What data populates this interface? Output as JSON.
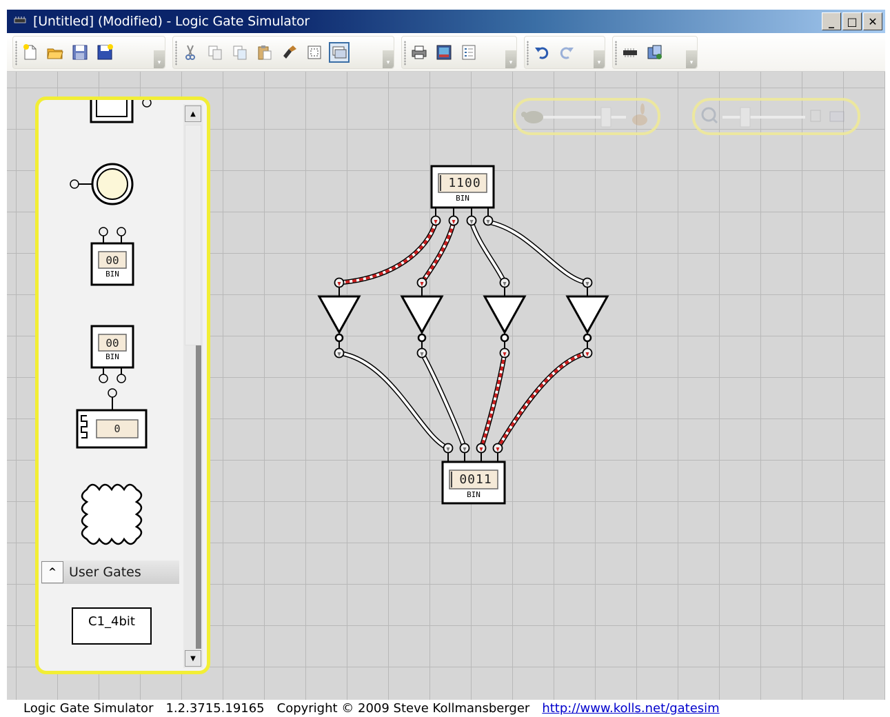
{
  "window": {
    "title": "[Untitled] (Modified) - Logic Gate Simulator",
    "minimize_label": "_",
    "maximize_label": "□",
    "close_label": "✕"
  },
  "toolbar": {
    "groups": [
      {
        "name": "file",
        "icons": [
          "new-icon",
          "open-icon",
          "save-icon",
          "save-as-icon"
        ]
      },
      {
        "name": "edit",
        "icons": [
          "cut-icon",
          "copy-icon",
          "copy-as-image-icon",
          "paste-icon",
          "delete-icon",
          "select-all-icon",
          "wire-mode-icon"
        ]
      },
      {
        "name": "print",
        "icons": [
          "print-icon",
          "print-preview-icon",
          "properties-icon"
        ]
      },
      {
        "name": "history",
        "icons": [
          "undo-icon",
          "redo-icon"
        ]
      },
      {
        "name": "ic",
        "icons": [
          "chip-icon",
          "ic-manage-icon"
        ]
      }
    ]
  },
  "palette": {
    "input_display_value": "00",
    "input_display_mode": "BIN",
    "output_display_value": "00",
    "output_display_mode": "BIN",
    "clock_value": "0",
    "user_gates_label": "User Gates",
    "collapse_glyph": "^",
    "user_gate_label": "C1_4bit",
    "scroll_up_glyph": "▲",
    "scroll_down_glyph": "▼"
  },
  "circuit": {
    "input_value": "1100",
    "input_mode": "BIN",
    "output_value": "0011",
    "output_mode": "BIN"
  },
  "colors": {
    "wire_active": "#cc1f1f",
    "wire_inactive": "#ffffff",
    "palette_border": "#f2ee35",
    "grid": "#b8b8b8",
    "canvas": "#d6d6d6"
  },
  "status": {
    "app_name": "Logic Gate Simulator",
    "version": "1.2.3715.19165",
    "copyright": "Copyright © 2009 Steve Kollmansberger",
    "url": "http://www.kolls.net/gatesim"
  }
}
